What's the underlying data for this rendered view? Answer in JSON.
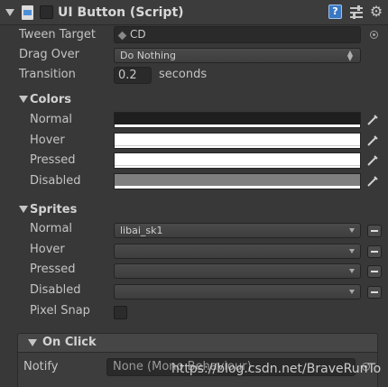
{
  "header": {
    "title": "UI Button (Script)",
    "enabled": true
  },
  "tween_target": {
    "label": "Tween Target",
    "value": "CD"
  },
  "drag_over": {
    "label": "Drag Over",
    "value": "Do Nothing"
  },
  "transition": {
    "label": "Transition",
    "value": "0.2",
    "unit": "seconds"
  },
  "colors": {
    "title": "Colors",
    "rows": [
      {
        "label": "Normal",
        "color": "#1e1e1e"
      },
      {
        "label": "Hover",
        "color": "#ffffff"
      },
      {
        "label": "Pressed",
        "color": "#ffffff"
      },
      {
        "label": "Disabled",
        "color": "#7f7f7f"
      }
    ]
  },
  "sprites": {
    "title": "Sprites",
    "rows": [
      {
        "label": "Normal",
        "value": "libai_sk1"
      },
      {
        "label": "Hover",
        "value": ""
      },
      {
        "label": "Pressed",
        "value": ""
      },
      {
        "label": "Disabled",
        "value": ""
      }
    ],
    "pixel_snap_label": "Pixel Snap"
  },
  "on_click": {
    "title": "On Click",
    "notify_label": "Notify",
    "notify_value": "None (Mono Behaviour)"
  },
  "watermark": "https://blog.csdn.net/BraveRunTo",
  "theme": {
    "background": "#383838",
    "field": "#2a2a2a",
    "accent_icon": "#3b78c4"
  }
}
